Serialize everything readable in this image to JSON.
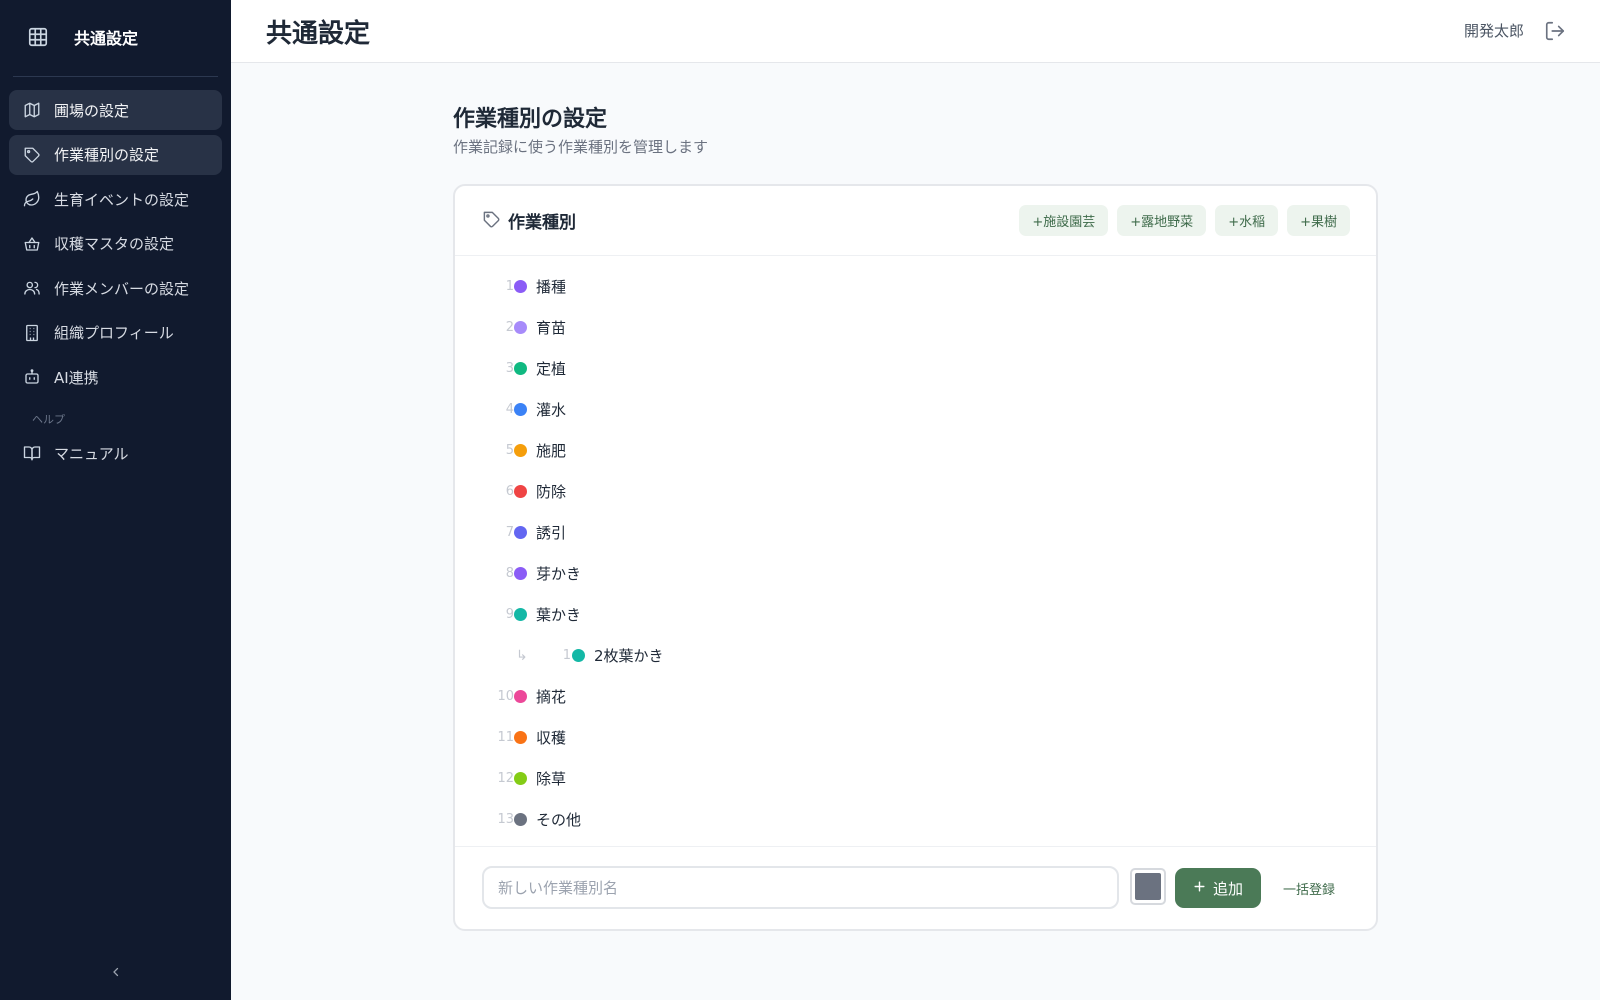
{
  "sidebar": {
    "title": "共通設定",
    "icon": "grid-icon",
    "items": [
      {
        "label": "圃場の設定",
        "icon": "map-icon",
        "active": true
      },
      {
        "label": "作業種別の設定",
        "icon": "tag-icon",
        "active": true
      },
      {
        "label": "生育イベントの設定",
        "icon": "leaf-icon",
        "active": false
      },
      {
        "label": "収穫マスタの設定",
        "icon": "basket-icon",
        "active": false
      },
      {
        "label": "作業メンバーの設定",
        "icon": "users-icon",
        "active": false
      },
      {
        "label": "組織プロフィール",
        "icon": "building-icon",
        "active": false
      },
      {
        "label": "AI連携",
        "icon": "bot-icon",
        "active": false
      }
    ],
    "help_section": "ヘルプ",
    "help_items": [
      {
        "label": "マニュアル",
        "icon": "book-icon"
      }
    ],
    "collapse_icon": "chevron-left-icon"
  },
  "header": {
    "title": "共通設定",
    "user_name": "開発太郎",
    "logout_icon": "logout-icon"
  },
  "section": {
    "title": "作業種別の設定",
    "subtitle": "作業記録に使う作業種別を管理します"
  },
  "card": {
    "title": "作業種別",
    "presets": [
      "+施設園芸",
      "+露地野菜",
      "+水稲",
      "+果樹"
    ],
    "work_types": [
      {
        "num": "1",
        "label": "播種",
        "color": "#8b5cf6"
      },
      {
        "num": "2",
        "label": "育苗",
        "color": "#a78bfa"
      },
      {
        "num": "3",
        "label": "定植",
        "color": "#10b981"
      },
      {
        "num": "4",
        "label": "灌水",
        "color": "#3b82f6"
      },
      {
        "num": "5",
        "label": "施肥",
        "color": "#f59e0b"
      },
      {
        "num": "6",
        "label": "防除",
        "color": "#ef4444"
      },
      {
        "num": "7",
        "label": "誘引",
        "color": "#6366f1"
      },
      {
        "num": "8",
        "label": "芽かき",
        "color": "#8b5cf6"
      },
      {
        "num": "9",
        "label": "葉かき",
        "color": "#14b8a6",
        "children": [
          {
            "num": "1",
            "label": "2枚葉かき",
            "color": "#14b8a6"
          }
        ]
      },
      {
        "num": "10",
        "label": "摘花",
        "color": "#ec4899"
      },
      {
        "num": "11",
        "label": "収穫",
        "color": "#f97316"
      },
      {
        "num": "12",
        "label": "除草",
        "color": "#84cc16"
      },
      {
        "num": "13",
        "label": "その他",
        "color": "#6b7280"
      }
    ],
    "new_input_placeholder": "新しい作業種別名",
    "new_input_value": "",
    "default_color": "#6b7280",
    "add_label": "追加",
    "bulk_label": "一括登録"
  }
}
